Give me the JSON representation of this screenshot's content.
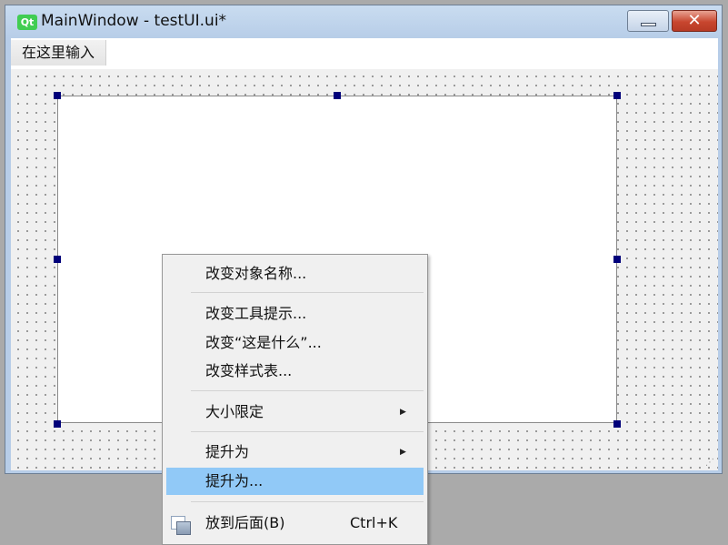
{
  "window": {
    "app_icon": "Qt",
    "title": "MainWindow - testUI.ui*",
    "minimize_icon": "minimize-icon",
    "close_icon": "close-icon",
    "close_glyph": "✕"
  },
  "menubar": {
    "items": [
      {
        "label": "在这里输入"
      }
    ]
  },
  "context_menu": {
    "items": [
      {
        "label": "改变对象名称..."
      },
      {
        "label": "改变工具提示..."
      },
      {
        "label": "改变“这是什么”..."
      },
      {
        "label": "改变样式表..."
      },
      {
        "label": "大小限定",
        "submenu": true
      },
      {
        "label": "提升为",
        "submenu": true
      },
      {
        "label": "提升为...",
        "highlighted": true
      },
      {
        "label": "放到后面(B)",
        "shortcut": "Ctrl+K",
        "icon": "send-to-back-icon"
      }
    ],
    "submenu_arrow": "▶"
  },
  "colors": {
    "highlight": "#91c9f7",
    "selection_handle": "#00007a",
    "qt_logo": "#41cd52",
    "close_button": "#c8462f"
  }
}
